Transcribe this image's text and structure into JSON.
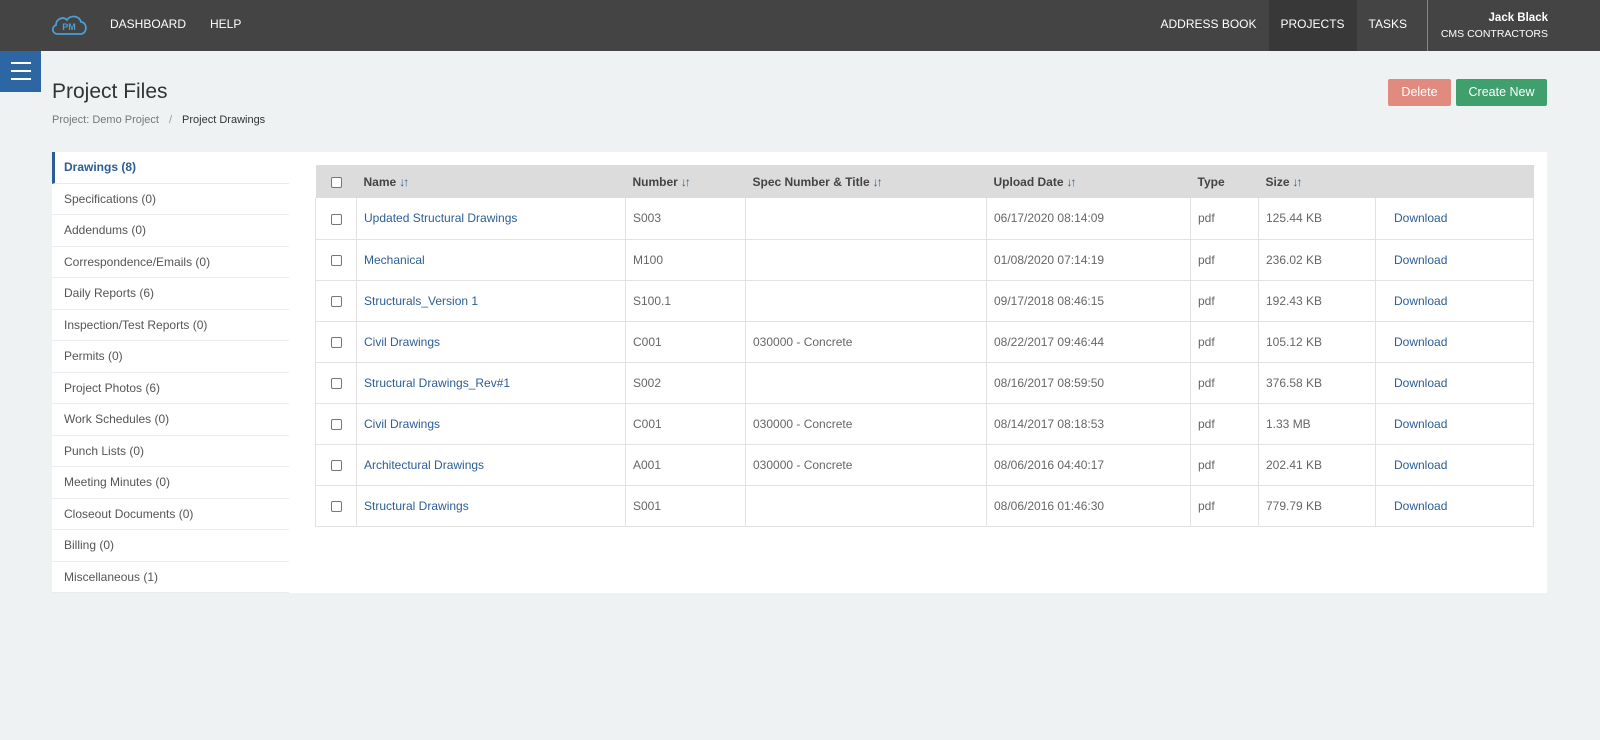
{
  "nav": {
    "logo_text": "PM",
    "left_items": [
      "DASHBOARD",
      "HELP"
    ],
    "right_items": [
      "ADDRESS BOOK",
      "PROJECTS",
      "TASKS"
    ],
    "active_item": "PROJECTS",
    "user": {
      "name": "Jack Black",
      "company": "CMS CONTRACTORS"
    }
  },
  "header": {
    "title": "Project Files",
    "breadcrumb": {
      "parent": "Project: Demo Project",
      "separator": "/",
      "current": "Project Drawings"
    },
    "delete_label": "Delete",
    "create_label": "Create New"
  },
  "sidebar": {
    "items": [
      "Drawings (8)",
      "Specifications (0)",
      "Addendums (0)",
      "Correspondence/Emails (0)",
      "Daily Reports (6)",
      "Inspection/Test Reports (0)",
      "Permits (0)",
      "Project Photos (6)",
      "Work Schedules (0)",
      "Punch Lists (0)",
      "Meeting Minutes (0)",
      "Closeout Documents (0)",
      "Billing (0)",
      "Miscellaneous (1)"
    ],
    "active_index": 0
  },
  "table": {
    "headers": {
      "name": "Name",
      "number": "Number",
      "spec": "Spec Number & Title",
      "upload_date": "Upload Date",
      "type": "Type",
      "size": "Size"
    },
    "download_label": "Download",
    "rows": [
      {
        "name": "Updated Structural Drawings",
        "number": "S003",
        "spec": "",
        "upload_date": "06/17/2020 08:14:09",
        "type": "pdf",
        "size": "125.44 KB"
      },
      {
        "name": "Mechanical",
        "number": "M100",
        "spec": "",
        "upload_date": "01/08/2020 07:14:19",
        "type": "pdf",
        "size": "236.02 KB"
      },
      {
        "name": "Structurals_Version 1",
        "number": "S100.1",
        "spec": "",
        "upload_date": "09/17/2018 08:46:15",
        "type": "pdf",
        "size": "192.43 KB"
      },
      {
        "name": "Civil Drawings",
        "number": "C001",
        "spec": "030000 - Concrete",
        "upload_date": "08/22/2017 09:46:44",
        "type": "pdf",
        "size": "105.12 KB"
      },
      {
        "name": "Structural Drawings_Rev#1",
        "number": "S002",
        "spec": "",
        "upload_date": "08/16/2017 08:59:50",
        "type": "pdf",
        "size": "376.58 KB"
      },
      {
        "name": "Civil Drawings",
        "number": "C001",
        "spec": "030000 - Concrete",
        "upload_date": "08/14/2017 08:18:53",
        "type": "pdf",
        "size": "1.33 MB"
      },
      {
        "name": "Architectural Drawings",
        "number": "A001",
        "spec": "030000 - Concrete",
        "upload_date": "08/06/2016 04:40:17",
        "type": "pdf",
        "size": "202.41 KB"
      },
      {
        "name": "Structural Drawings",
        "number": "S001",
        "spec": "",
        "upload_date": "08/06/2016 01:46:30",
        "type": "pdf",
        "size": "779.79 KB"
      }
    ]
  },
  "colors": {
    "topbar": "#444444",
    "accent": "#2c5d96",
    "delete": "#e08a80",
    "create": "#3fa06e"
  }
}
